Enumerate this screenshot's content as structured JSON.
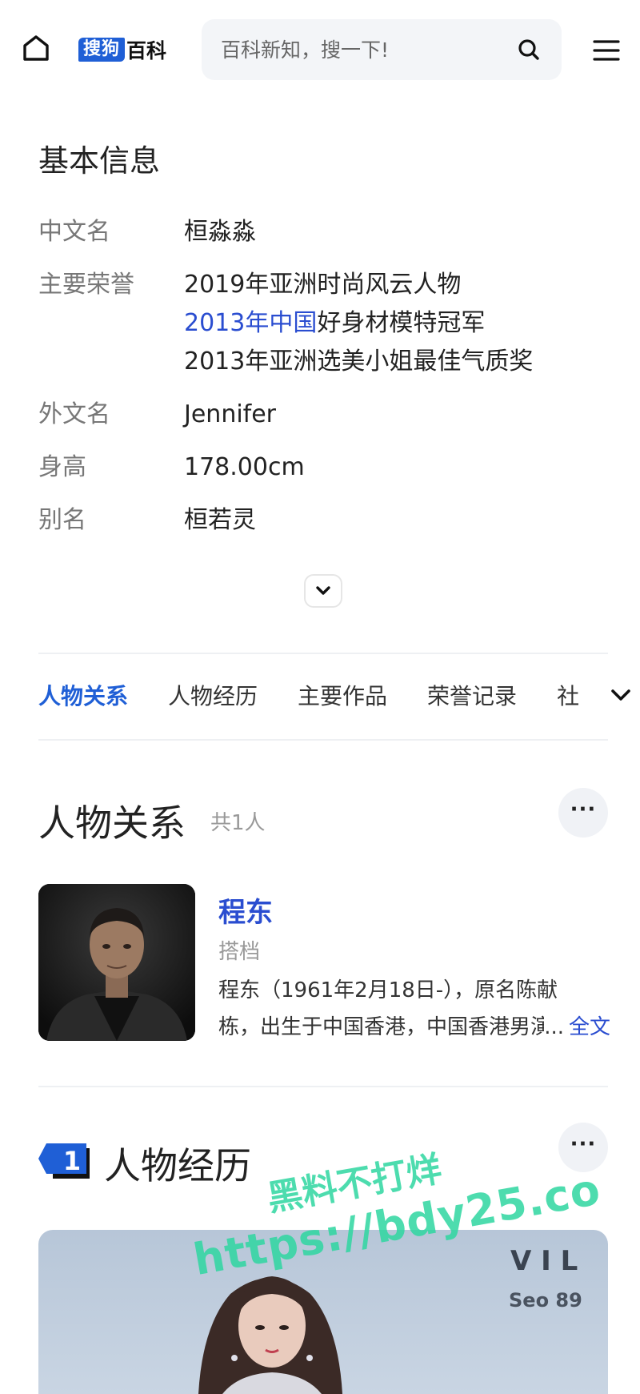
{
  "header": {
    "logo_box": "搜狗",
    "logo_text": "百科",
    "search_placeholder": "百科新知，搜一下!"
  },
  "basic_info": {
    "title": "基本信息",
    "rows": [
      {
        "key": "中文名",
        "values": [
          "桓淼淼"
        ]
      },
      {
        "key": "主要荣誉",
        "values": [
          "2019年亚洲时尚风云人物",
          "2013年中国好身材模特冠军",
          "2013年亚洲选美小姐最佳气质奖"
        ]
      },
      {
        "key": "外文名",
        "values": [
          "Jennifer"
        ]
      },
      {
        "key": "身高",
        "values": [
          "178.00cm"
        ]
      },
      {
        "key": "别名",
        "values": [
          "桓若灵"
        ]
      }
    ],
    "honor_link": "2013年中国",
    "honor_rest": "好身材模特冠军"
  },
  "tabs": [
    "人物关系",
    "人物经历",
    "主要作品",
    "荣誉记录",
    "社"
  ],
  "relations": {
    "title": "人物关系",
    "count": "共1人",
    "person": {
      "name": "程东",
      "role": "搭档",
      "desc_line1": "程东（1961年2月18日-），原名陈献",
      "desc_line2": "栋，出生于中国香港，中国香港男演员",
      "ellipsis": "...",
      "more_link": "全文"
    }
  },
  "experience": {
    "number": "1",
    "title": "人物经历"
  },
  "watermark": {
    "line1": "黑料不打烊",
    "line2": "https://bdy25.co"
  },
  "colors": {
    "brand_blue": "#1f5fd6",
    "link_blue": "#2a4dd0",
    "watermark_green": "#2ed6a0"
  }
}
